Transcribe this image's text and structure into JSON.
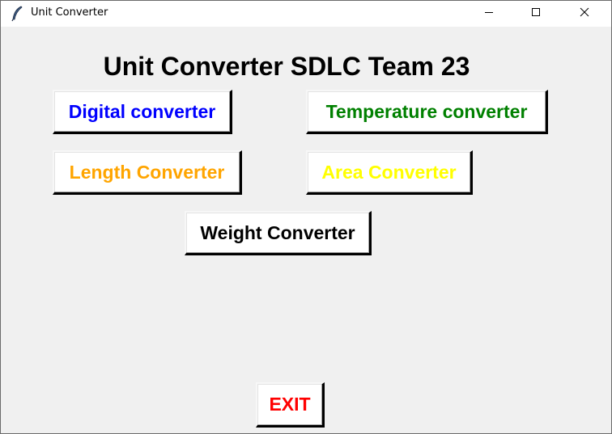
{
  "window": {
    "title": "Unit Converter",
    "controls": {
      "minimize_icon": "minimize-icon",
      "maximize_icon": "maximize-icon",
      "close_icon": "close-icon"
    }
  },
  "main": {
    "heading": "Unit Converter SDLC Team 23",
    "buttons": {
      "digital": {
        "label": "Digital converter",
        "color": "#0000ff"
      },
      "temperature": {
        "label": "Temperature converter",
        "color": "#008000"
      },
      "length": {
        "label": "Length Converter",
        "color": "#ffa500"
      },
      "area": {
        "label": "Area Converter",
        "color": "#ffff00"
      },
      "weight": {
        "label": "Weight Converter",
        "color": "#000000"
      },
      "exit": {
        "label": "EXIT",
        "color": "#ff0000"
      }
    }
  },
  "colors": {
    "background": "#f0f0f0",
    "titlebar": "#ffffff"
  }
}
